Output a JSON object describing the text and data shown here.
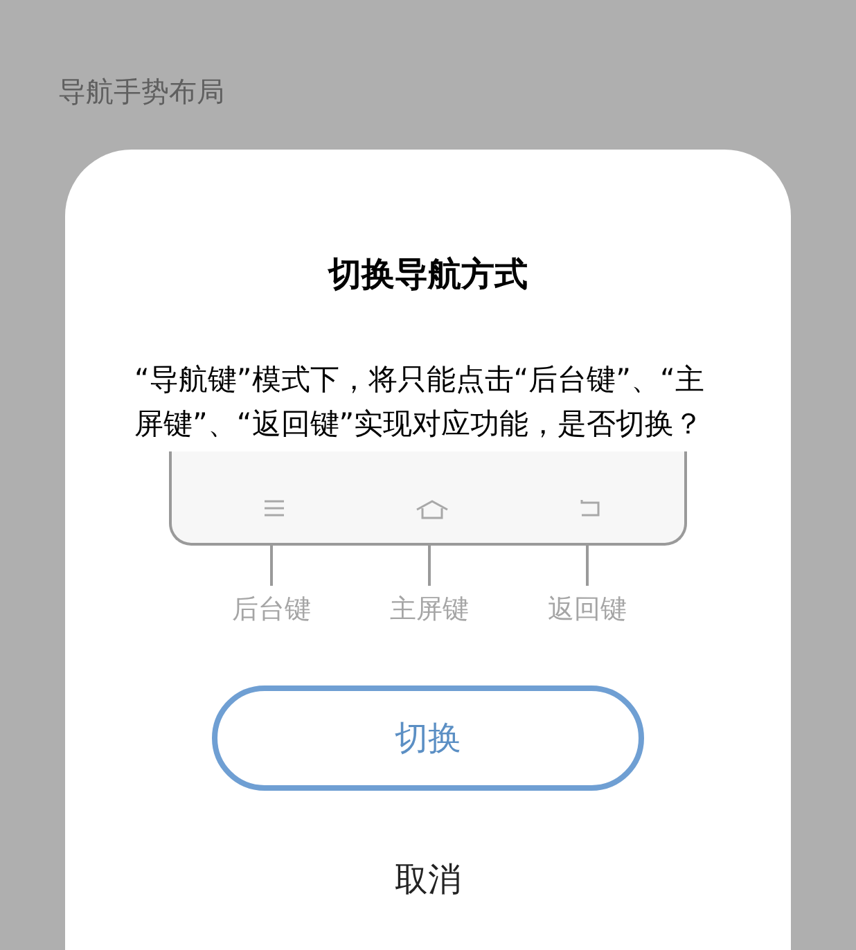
{
  "page": {
    "section_title": "导航手势布局"
  },
  "dialog": {
    "title": "切换导航方式",
    "message": "“导航键”模式下，将只能点击“后台键”、“主屏键”、“返回键”实现对应功能，是否切换？",
    "keys": [
      {
        "kind": "recent",
        "label": "后台键"
      },
      {
        "kind": "home",
        "label": "主屏键"
      },
      {
        "kind": "back",
        "label": "返回键"
      }
    ],
    "confirm": "切换",
    "cancel": "取消"
  }
}
